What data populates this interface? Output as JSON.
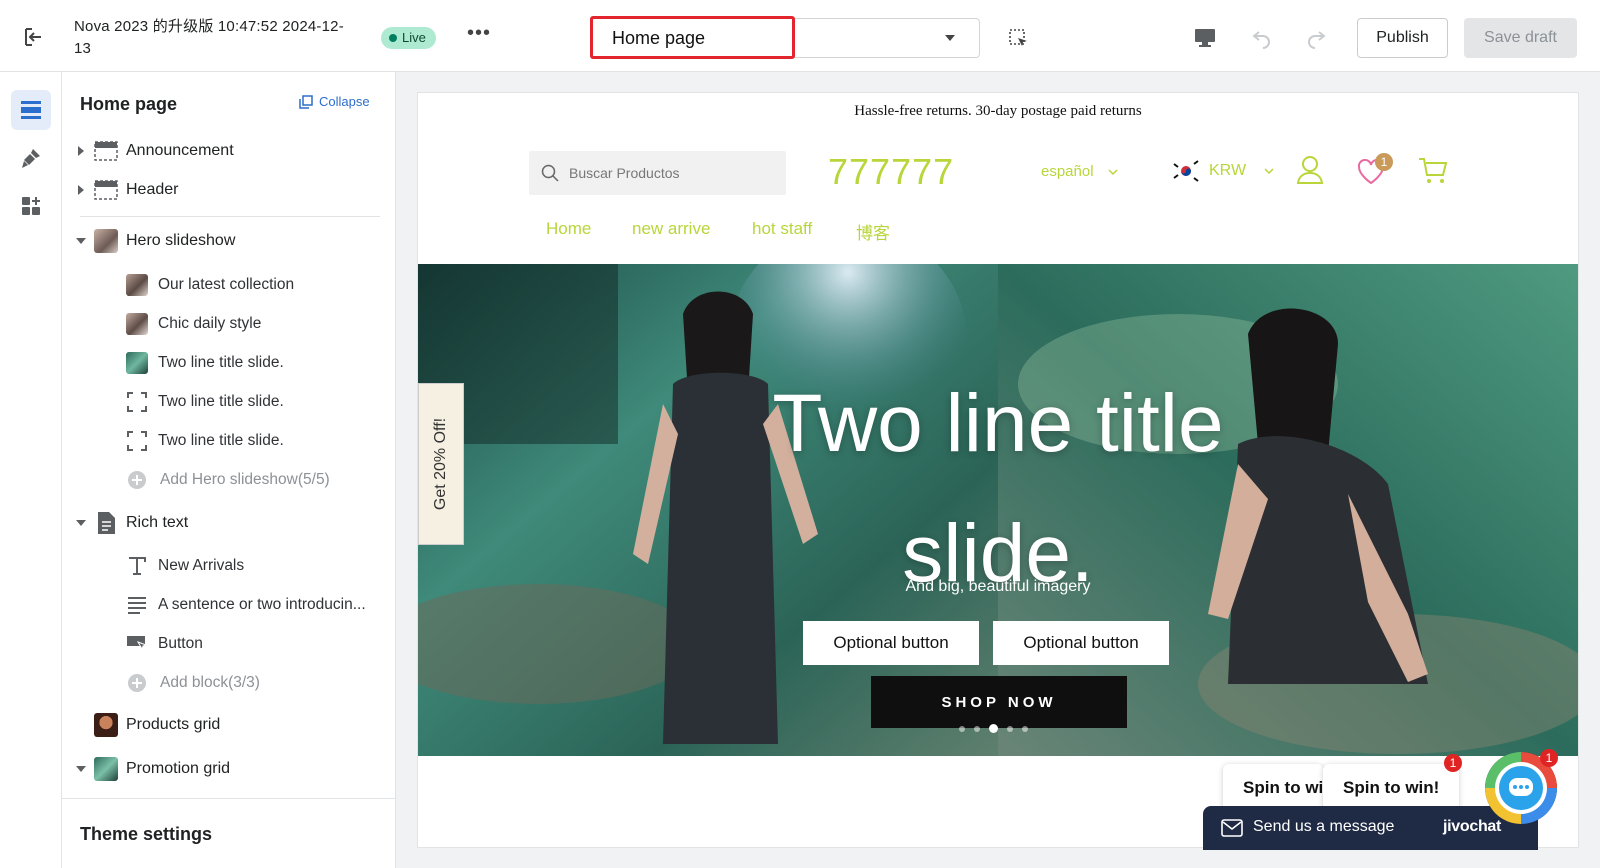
{
  "topbar": {
    "store_name": "Nova 2023 的升级版 10:47:52 2024-12-13",
    "status": "Live",
    "more_label": "•••",
    "page_select": "Home page",
    "publish": "Publish",
    "save_draft": "Save draft"
  },
  "sidebar": {
    "title": "Home page",
    "collapse": "Collapse",
    "sections": {
      "announcement": "Announcement",
      "header": "Header",
      "hero": "Hero slideshow",
      "hero_items": [
        "Our latest collection",
        "Chic daily style",
        "Two line title slide.",
        "Two line title slide.",
        "Two line title slide."
      ],
      "hero_add": "Add Hero slideshow(5/5)",
      "rich_text": "Rich text",
      "rich_items": [
        "New Arrivals",
        "A sentence or two introducin...",
        "Button"
      ],
      "rich_add": "Add block(3/3)",
      "products_grid": "Products grid",
      "promotion_grid": "Promotion grid"
    },
    "theme_settings": "Theme settings"
  },
  "preview": {
    "announcement": "Hassle-free returns. 30-day postage paid returns",
    "search_placeholder": "Buscar Productos",
    "logo": "777777",
    "language": "español",
    "currency": "KRW",
    "wishlist_count": "1",
    "nav": [
      "Home",
      "new arrive",
      "hot staff",
      "博客"
    ],
    "hero": {
      "title": "Two line title slide.",
      "subtitle": "And big, beautiful imagery",
      "button1": "Optional button",
      "button2": "Optional button",
      "shop_now": "SHOP NOW"
    },
    "side_tab": "Get 20% Off!"
  },
  "widgets": {
    "spin1": "Spin to win!",
    "spin2": "Spin to win!",
    "chat_message": "Send us a message",
    "chat_brand": "jivochat",
    "chat_badge": "1",
    "spin_badge": "1"
  },
  "colors": {
    "accent": "#b8d63a",
    "highlight": "#e3262e",
    "brand_blue": "#2c6ecb"
  }
}
